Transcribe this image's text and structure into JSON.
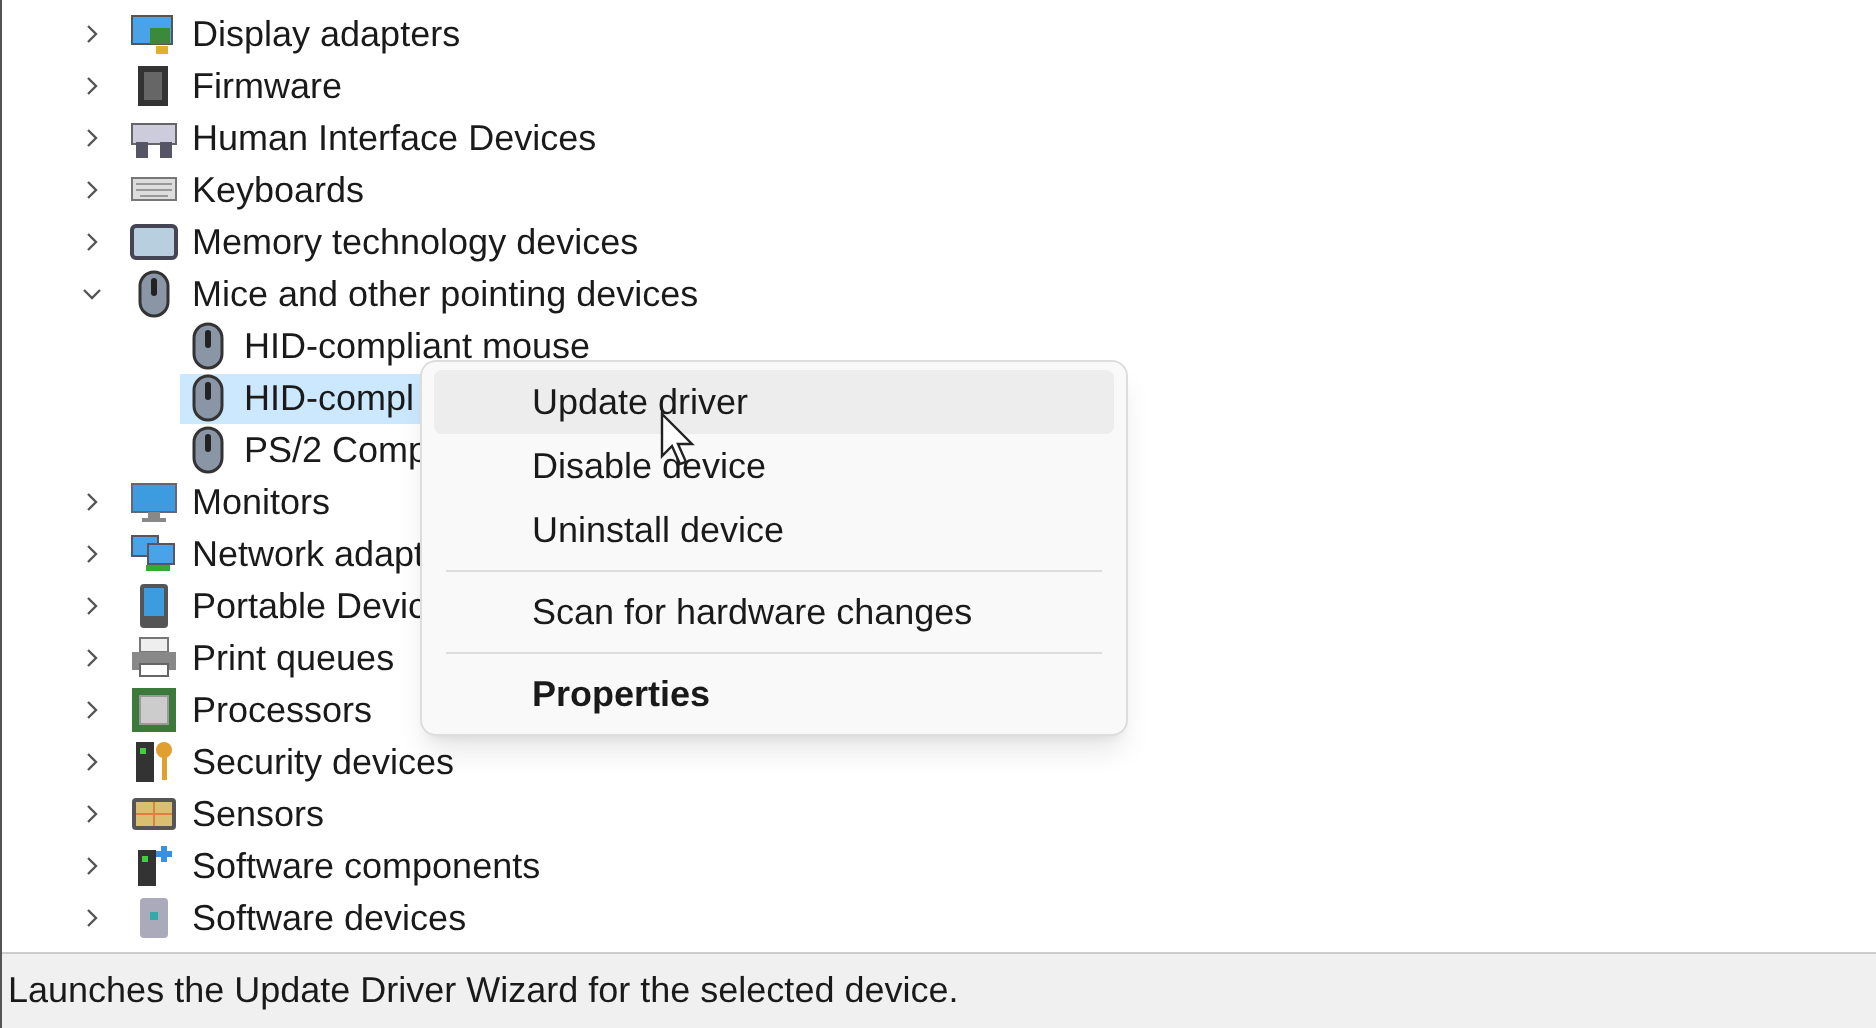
{
  "tree": [
    {
      "label": "Display adapters",
      "expanded": false
    },
    {
      "label": "Firmware",
      "expanded": false
    },
    {
      "label": "Human Interface Devices",
      "expanded": false
    },
    {
      "label": "Keyboards",
      "expanded": false
    },
    {
      "label": "Memory technology devices",
      "expanded": false
    },
    {
      "label": "Mice and other pointing devices",
      "expanded": true,
      "children": [
        {
          "label": "HID-compliant mouse",
          "selected": false
        },
        {
          "label": "HID-compl",
          "selected": true
        },
        {
          "label": "PS/2 Comp",
          "selected": false
        }
      ]
    },
    {
      "label": "Monitors",
      "expanded": false
    },
    {
      "label": "Network adapt",
      "expanded": false
    },
    {
      "label": "Portable Devic",
      "expanded": false
    },
    {
      "label": "Print queues",
      "expanded": false
    },
    {
      "label": "Processors",
      "expanded": false
    },
    {
      "label": "Security devices",
      "expanded": false
    },
    {
      "label": "Sensors",
      "expanded": false
    },
    {
      "label": "Software components",
      "expanded": false
    },
    {
      "label": "Software devices",
      "expanded": false
    }
  ],
  "context_menu": [
    {
      "kind": "item",
      "label": "Update driver",
      "selected": true,
      "default": false
    },
    {
      "kind": "item",
      "label": "Disable device",
      "selected": false,
      "default": false
    },
    {
      "kind": "item",
      "label": "Uninstall device",
      "selected": false,
      "default": false
    },
    {
      "kind": "separator"
    },
    {
      "kind": "item",
      "label": "Scan for hardware changes",
      "selected": false,
      "default": false
    },
    {
      "kind": "separator"
    },
    {
      "kind": "item",
      "label": "Properties",
      "selected": false,
      "default": true
    }
  ],
  "status_bar": "Launches the Update Driver Wizard for the selected device."
}
